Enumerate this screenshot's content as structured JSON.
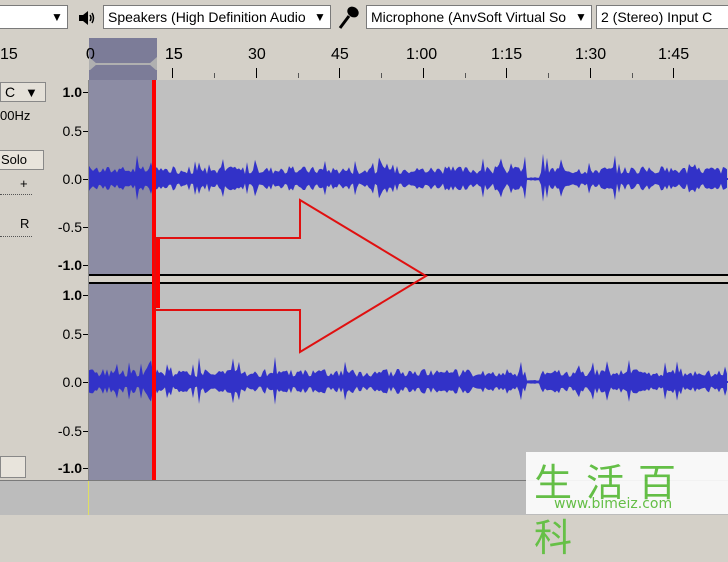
{
  "device_toolbar": {
    "host_select": "",
    "speaker_icon": "speaker-icon",
    "playback_device": "Speakers (High Definition Audio",
    "microphone_icon": "microphone-icon",
    "recording_device": "Microphone (AnvSoft Virtual So",
    "channels": "2 (Stereo) Input C"
  },
  "timeline": {
    "labels": [
      "15",
      "0",
      "15",
      "30",
      "45",
      "1:00",
      "1:15",
      "1:30",
      "1:45"
    ]
  },
  "track": {
    "name_fragment": "C",
    "rate_fragment": "00Hz",
    "solo_label": "Solo",
    "gain_plus": "+",
    "pan_right": "R"
  },
  "scale": {
    "top_channel": [
      "1.0",
      "0.5",
      "0.0",
      "-0.5",
      "-1.0"
    ],
    "bottom_channel": [
      "1.0",
      "0.5",
      "0.0",
      "-0.5",
      "-1.0"
    ]
  },
  "colors": {
    "waveform": "#3232c8",
    "selection": "#8c8ca4",
    "cursor": "#ff0000",
    "annotation_arrow": "#e01010",
    "background": "#c0c0c0"
  },
  "watermark": {
    "chinese": "生活百科",
    "url": "www.bimeiz.com"
  }
}
